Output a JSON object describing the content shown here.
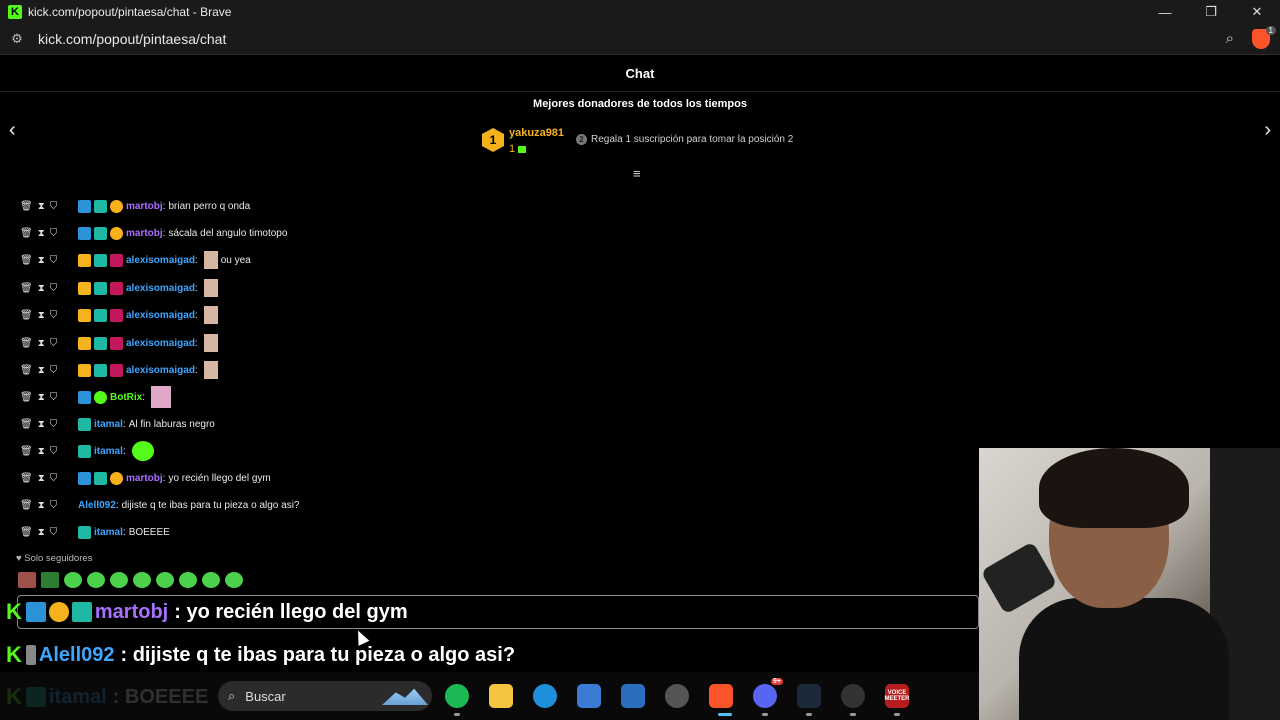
{
  "window": {
    "title": "kick.com/popout/pintaesa/chat - Brave",
    "url": "kick.com/popout/pintaesa/chat",
    "minimize": "—",
    "maximize": "❐",
    "close": "✕",
    "brave_badge": "1"
  },
  "chat": {
    "header": "Chat",
    "donors_title": "Mejores donadores de todos los tiempos",
    "top_donor": {
      "rank": "1",
      "name": "yakuza981",
      "count": "1"
    },
    "position_hint": "Regala 1 suscripción para tomar la posición 2",
    "followers_only": "Solo seguidores",
    "messages": [
      {
        "user": "martobj",
        "text": "brian perro q onda",
        "color": "#a970ff"
      },
      {
        "user": "martobj",
        "text": "sácala del angulo timotopo",
        "color": "#a970ff"
      },
      {
        "user": "alexisomaigad",
        "text": "ou yea",
        "color": "#3ea6ff"
      },
      {
        "user": "alexisomaigad",
        "text": "",
        "color": "#3ea6ff"
      },
      {
        "user": "alexisomaigad",
        "text": "",
        "color": "#3ea6ff"
      },
      {
        "user": "alexisomaigad",
        "text": "",
        "color": "#3ea6ff"
      },
      {
        "user": "alexisomaigad",
        "text": "",
        "color": "#3ea6ff"
      },
      {
        "user": "BotRix",
        "text": "",
        "color": "#53fc18"
      },
      {
        "user": "itamal",
        "text": "Al fin laburas negro",
        "color": "#3ea6ff"
      },
      {
        "user": "itamal",
        "text": "",
        "color": "#3ea6ff"
      },
      {
        "user": "martobj",
        "text": "yo recién llego del gym",
        "color": "#a970ff"
      },
      {
        "user": "Alell092",
        "text": "dijiste q te ibas para tu pieza o algo asi?",
        "color": "#3ea6ff"
      },
      {
        "user": "itamal",
        "text": "BOEEEE",
        "color": "#3ea6ff"
      }
    ]
  },
  "overlay": [
    {
      "user": "martobj",
      "text": ": yo recién llego del gym",
      "color": "#a970ff"
    },
    {
      "user": "Alell092",
      "text": ": dijiste q te ibas para tu pieza o algo asi?",
      "color": "#3ea6ff"
    },
    {
      "user": "itamal",
      "text": ": BOEEEE",
      "color": "#3ea6ff"
    }
  ],
  "taskbar": {
    "search_placeholder": "Buscar",
    "discord_badge": "9+",
    "voice_label": "VOICE",
    "meeter_label": "MEETER"
  }
}
